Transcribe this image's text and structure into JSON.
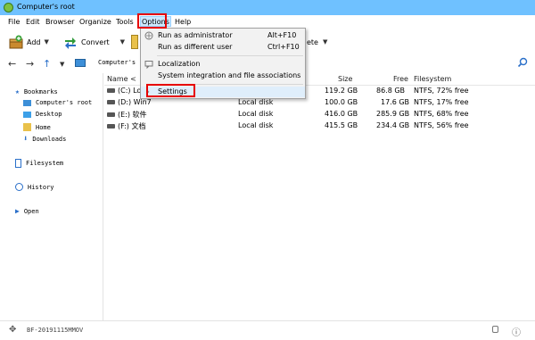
{
  "window": {
    "title": "Computer's root"
  },
  "menubar": {
    "items": [
      {
        "label": "File"
      },
      {
        "label": "Edit"
      },
      {
        "label": "Browser"
      },
      {
        "label": "Organize"
      },
      {
        "label": "Tools"
      },
      {
        "label": "Options",
        "active": true
      },
      {
        "label": "Help"
      }
    ]
  },
  "toolbar": {
    "add_label": "Add",
    "convert_label": "Convert",
    "delete_label": "ete"
  },
  "address": {
    "crumb": "Computer's r"
  },
  "options_menu": {
    "items": [
      {
        "label": "Run as administrator",
        "shortcut": "Alt+F10"
      },
      {
        "label": "Run as different user",
        "shortcut": "Ctrl+F10"
      },
      {
        "label": "Localization",
        "shortcut": ""
      },
      {
        "label": "System integration and file associations",
        "shortcut": ""
      },
      {
        "label": "Settings",
        "shortcut": ""
      }
    ]
  },
  "sidebar": {
    "bookmarks": "Bookmarks",
    "items": [
      {
        "label": "Computer's root"
      },
      {
        "label": "Desktop"
      },
      {
        "label": "Home"
      },
      {
        "label": "Downloads"
      }
    ],
    "filesystem": "Filesystem",
    "history": "History",
    "open": "Open"
  },
  "table": {
    "headers": {
      "name": "Name <",
      "size": "Size",
      "free": "Free",
      "filesystem": "Filesystem"
    },
    "rows": [
      {
        "name": "(C:) Lo",
        "type": "",
        "size": "119.2 GB",
        "free": "86.8 GB",
        "fs": "NTFS, 72% free"
      },
      {
        "name": "(D:) Win7",
        "type": "Local disk",
        "size": "100.0 GB",
        "free": "17.6 GB",
        "fs": "NTFS, 17% free"
      },
      {
        "name": "(E:) 软件",
        "type": "Local disk",
        "size": "416.0 GB",
        "free": "285.9 GB",
        "fs": "NTFS, 68% free"
      },
      {
        "name": "(F:) 文档",
        "type": "Local disk",
        "size": "415.5 GB",
        "free": "234.4 GB",
        "fs": "NTFS, 56% free"
      }
    ]
  },
  "status": {
    "text": "BF-20191115MMOV"
  }
}
